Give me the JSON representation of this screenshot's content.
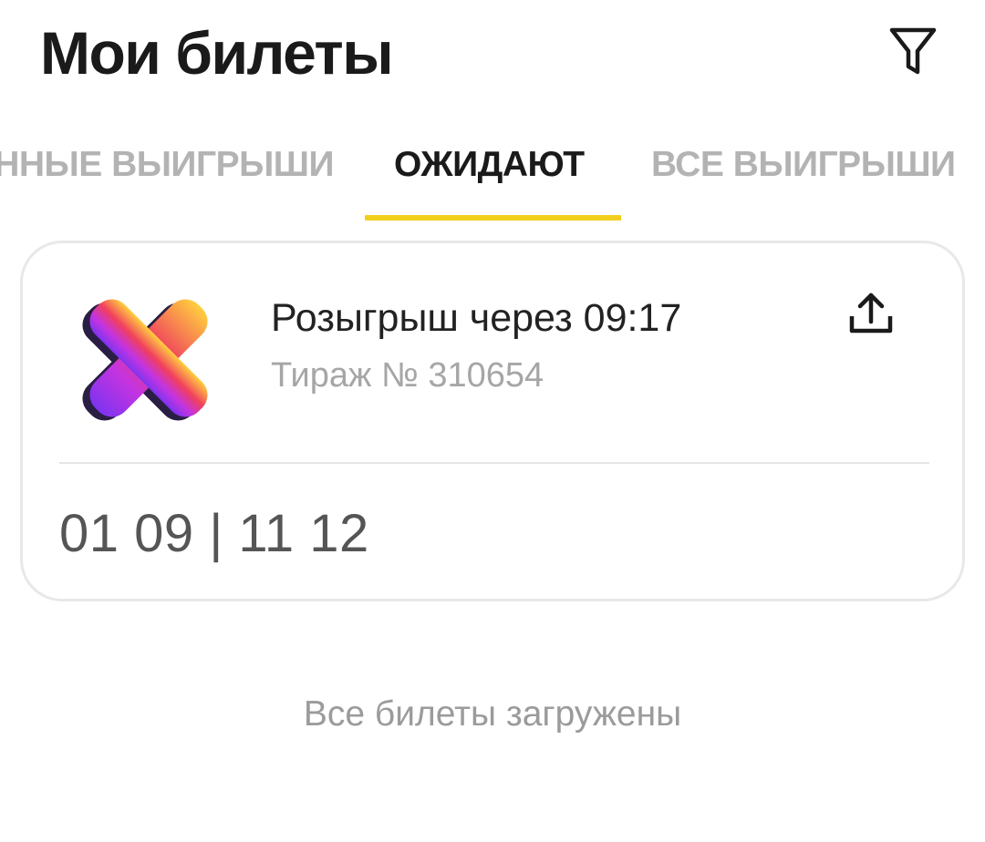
{
  "header": {
    "title": "Мои билеты",
    "filter_icon": "filter-funnel-icon"
  },
  "tabs": [
    {
      "label": "ЕННЫЕ ВЫИГРЫШИ",
      "active": false
    },
    {
      "label": "ОЖИДАЮТ",
      "active": true
    },
    {
      "label": "ВСЕ ВЫИГРЫШИ",
      "active": false
    }
  ],
  "ticket": {
    "logo_icon": "gradient-x-lottery-logo",
    "draw_label": "Розыгрыш через 09:17",
    "draw_number": "Тираж № 310654",
    "share_icon": "share-upload-icon",
    "numbers": "01 09 | 11 12"
  },
  "footer": {
    "note": "Все билеты загружены"
  },
  "colors": {
    "accent": "#f2cf1d",
    "title_text": "#1a1a1a",
    "muted_text": "#a6a6a6",
    "card_border": "#e8e8e8"
  }
}
